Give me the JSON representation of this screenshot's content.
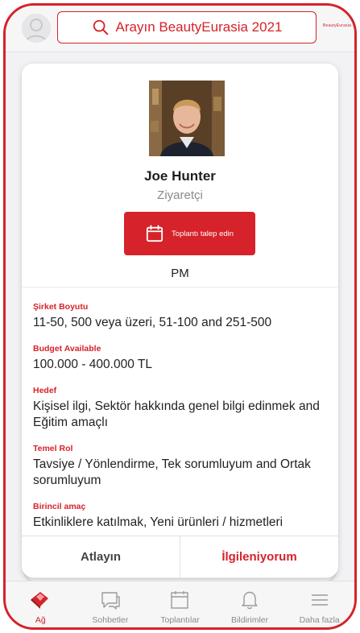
{
  "header": {
    "search_placeholder": "Arayın BeautyEurasia 2021",
    "brand_logo": "BeautyEurasia"
  },
  "profile": {
    "name": "Joe Hunter",
    "role": "Ziyaretçi",
    "meeting_button": "Toplantı talep edin",
    "company": "PM"
  },
  "details": [
    {
      "label": "Şirket Boyutu",
      "value": "11-50, 500 veya üzeri, 51-100 and 251-500"
    },
    {
      "label": "Budget Available",
      "value": "100.000 - 400.000 TL"
    },
    {
      "label": "Hedef",
      "value": "Kişisel ilgi, Sektör hakkında genel bilgi edinmek and Eğitim amaçlı"
    },
    {
      "label": "Temel Rol",
      "value": "Tavsiye / Yönlendirme, Tek sorumluyum and Ortak sorumluyum"
    },
    {
      "label": "Birincil amaç",
      "value": "Etkinliklere katılmak, Yeni ürünleri / hizmetleri"
    }
  ],
  "actions": {
    "skip": "Atlayın",
    "interested": "İlgileniyorum"
  },
  "tabs": [
    {
      "label": "Ağ",
      "icon": "network-icon",
      "active": true
    },
    {
      "label": "Sohbetler",
      "icon": "chat-icon",
      "active": false
    },
    {
      "label": "Toplantılar",
      "icon": "calendar-icon",
      "active": false
    },
    {
      "label": "Bildirimler",
      "icon": "bell-icon",
      "active": false
    },
    {
      "label": "Daha fazla",
      "icon": "menu-icon",
      "active": false
    }
  ],
  "colors": {
    "accent": "#d6222a",
    "muted": "#8a8a8a"
  }
}
